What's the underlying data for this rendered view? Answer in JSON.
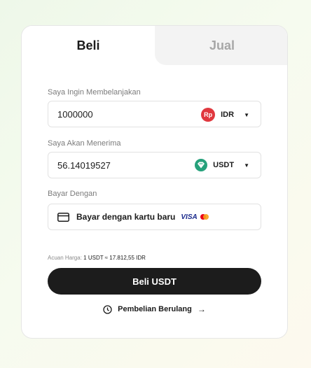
{
  "tabs": [
    {
      "label": "Beli",
      "active": true
    },
    {
      "label": "Jual",
      "active": false
    }
  ],
  "spend": {
    "label": "Saya Ingin Membelanjakan",
    "value": "1000000",
    "currency": "IDR",
    "currency_icon_text": "Rp",
    "currency_color": "#e0383e"
  },
  "receive": {
    "label": "Saya Akan Menerima",
    "value": "56.14019527",
    "currency": "USDT",
    "currency_color": "#26a17b"
  },
  "payment": {
    "label": "Bayar Dengan",
    "method": "Bayar dengan kartu baru",
    "visa_text": "VISA"
  },
  "price_ref": {
    "label": "Acuan Harga:",
    "rate": "1 USDT ≈ 17.812,55 IDR"
  },
  "buy_button": "Beli USDT",
  "recurring_link": "Pembelian Berulang",
  "icons": {
    "clock": "clock-icon",
    "card": "credit-card-icon",
    "arrow": "arrow-right-icon"
  },
  "colors": {
    "primary_button": "#1c1c1c",
    "inactive_tab_bg": "#f3f3f3"
  }
}
